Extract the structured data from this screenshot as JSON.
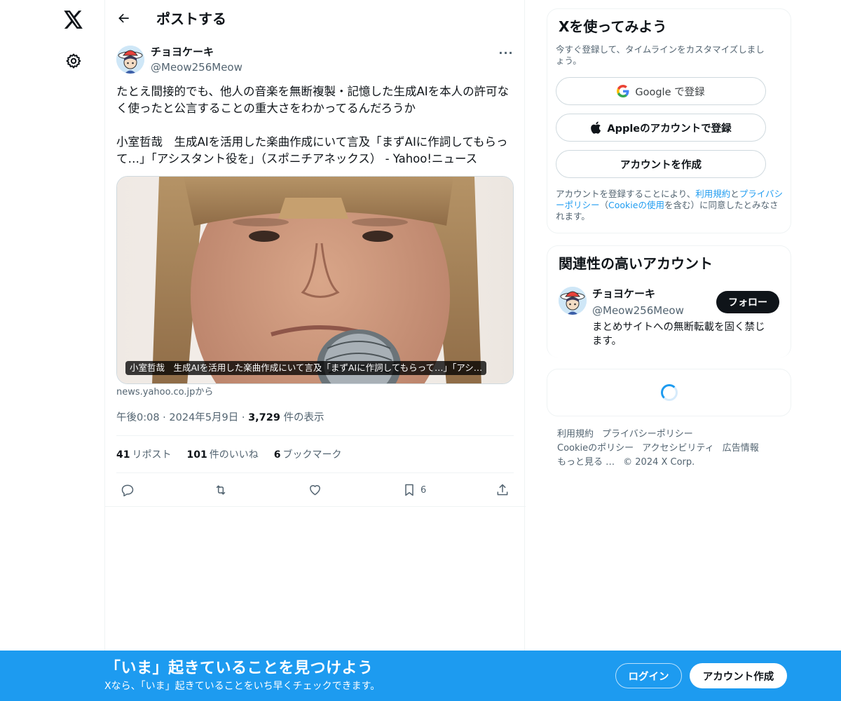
{
  "header": {
    "title": "ポストする"
  },
  "post": {
    "author_name": "チョヨケーキ",
    "author_handle": "@Meow256Meow",
    "text": "たとえ間接的でも、他人の音楽を無断複製・記憶した生成AIを本人の許可なく使ったと公言することの重大さをわかってるんだろうか\n\n小室哲哉　生成AIを活用した楽曲作成にいて言及「まずAIに作詞してもらって…」「アシスタント役を」（スポニチアネックス） - Yahoo!ニュース",
    "card_caption": "小室哲哉　生成AIを活用した楽曲作成にいて言及「まずAIに作詞してもらって…」「アシ…",
    "card_domain": "news.yahoo.co.jpから",
    "time": "午後0:08",
    "date": "2024年5月9日",
    "views_count": "3,729",
    "views_label": "件の表示",
    "reposts_count": "41",
    "reposts_label": "リポスト",
    "likes_count": "101",
    "likes_label": "件のいいね",
    "bookmarks_count": "6",
    "bookmarks_label": "ブックマーク",
    "bookmark_action_count": "6"
  },
  "signup_panel": {
    "title": "Xを使ってみよう",
    "subtitle": "今すぐ登録して、タイムラインをカスタマイズしましょう。",
    "google_label": "Google で登録",
    "apple_label": "Appleのアカウントで登録",
    "create_label": "アカウントを作成",
    "legal_prefix": "アカウントを登録することにより、",
    "legal_terms": "利用規約",
    "legal_and": "と",
    "legal_privacy": "プライバシーポリシー",
    "legal_open": "（",
    "legal_cookie": "Cookieの使用",
    "legal_suffix": "を含む）に同意したとみなされます。"
  },
  "related_panel": {
    "title": "関連性の高いアカウント",
    "name": "チョヨケーキ",
    "handle": "@Meow256Meow",
    "follow_label": "フォロー",
    "bio": "まとめサイトへの無断転載を固く禁じます。"
  },
  "footer": {
    "terms": "利用規約",
    "privacy": "プライバシーポリシー",
    "cookie": "Cookieのポリシー",
    "accessibility": "アクセシビリティ",
    "ads": "広告情報",
    "more": "もっと見る …",
    "copyright": "© 2024 X Corp."
  },
  "bottom_bar": {
    "title": "「いま」起きていることを見つけよう",
    "subtitle": "Xなら、「いま」起きていることをいち早くチェックできます。",
    "login_label": "ログイン",
    "signup_label": "アカウント作成"
  },
  "colors": {
    "accent": "#1d9bf0",
    "text": "#0f1419",
    "muted": "#536471"
  }
}
